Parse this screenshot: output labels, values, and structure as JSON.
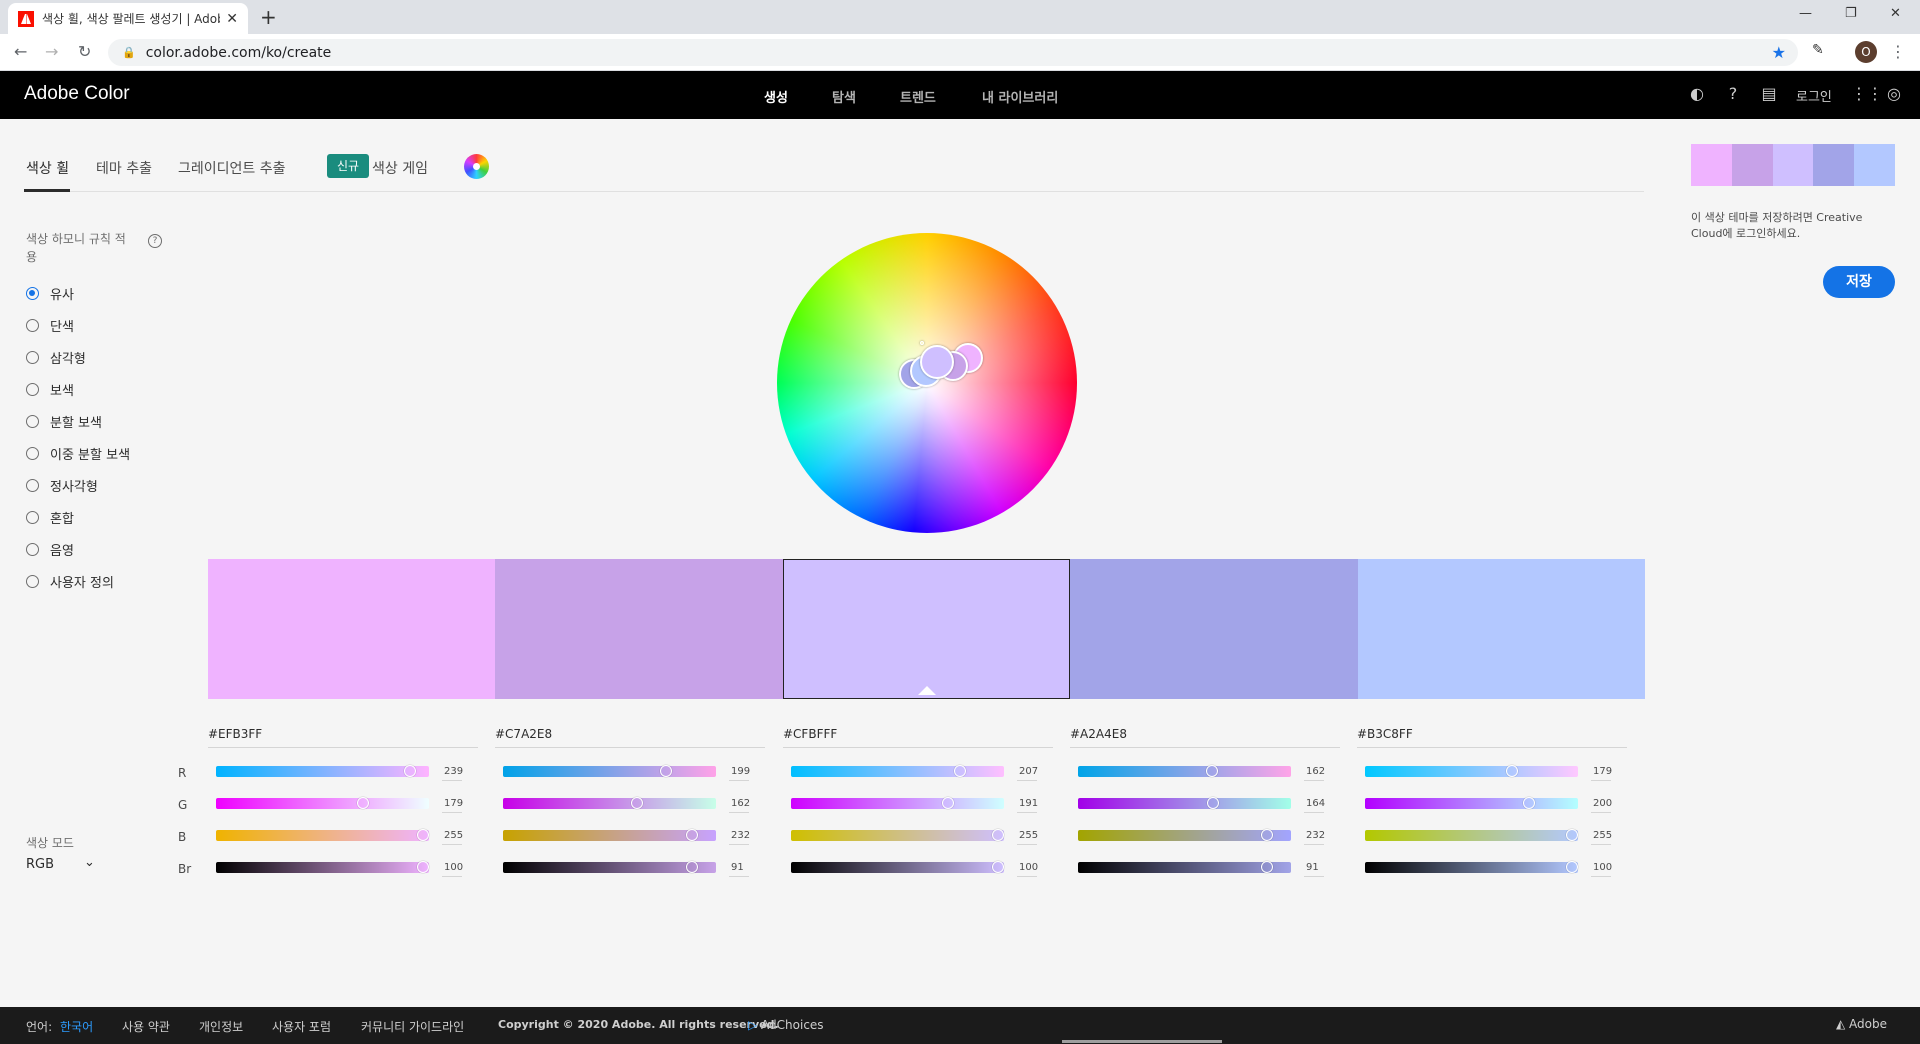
{
  "browser": {
    "tab_title": "색상 휠, 색상 팔레트 생성기 | Adobe Color",
    "url": "color.adobe.com/ko/create",
    "profile_initial": "O"
  },
  "header": {
    "brand": "Adobe Color",
    "nav": [
      "생성",
      "탐색",
      "트렌드",
      "내 라이브러리"
    ],
    "login": "로그인"
  },
  "subtabs": {
    "items": [
      "색상 휠",
      "테마 추출",
      "그레이디언트 추출",
      "색상 게임"
    ],
    "new_badge": "신규"
  },
  "rules": {
    "title": "색상 하모니 규칙 적용",
    "selected": "유사",
    "items": [
      "유사",
      "단색",
      "삼각형",
      "보색",
      "분할 보색",
      "이중 분할 보색",
      "정사각형",
      "혼합",
      "음영",
      "사용자 정의"
    ]
  },
  "color_mode": {
    "label": "색상 모드",
    "value": "RGB"
  },
  "channel_labels": [
    "R",
    "G",
    "B",
    "Br"
  ],
  "swatches": [
    {
      "hex": "#EFB3FF",
      "color": "#EFB3FF",
      "values": [
        "239",
        "179",
        "255",
        "100"
      ],
      "fractions": [
        0.937,
        0.702,
        1.0,
        1.0
      ]
    },
    {
      "hex": "#C7A2E8",
      "color": "#C7A2E8",
      "values": [
        "199",
        "162",
        "232",
        "91"
      ],
      "fractions": [
        0.78,
        0.635,
        0.91,
        0.91
      ]
    },
    {
      "hex": "#CFBFFF",
      "color": "#CFBFFF",
      "values": [
        "207",
        "191",
        "255",
        "100"
      ],
      "fractions": [
        0.812,
        0.749,
        1.0,
        1.0
      ]
    },
    {
      "hex": "#A2A4E8",
      "color": "#A2A4E8",
      "values": [
        "162",
        "164",
        "232",
        "91"
      ],
      "fractions": [
        0.635,
        0.643,
        0.91,
        0.91
      ]
    },
    {
      "hex": "#B3C8FF",
      "color": "#B3C8FF",
      "values": [
        "179",
        "200",
        "255",
        "100"
      ],
      "fractions": [
        0.702,
        0.784,
        1.0,
        1.0
      ]
    }
  ],
  "selected_swatch_index": 2,
  "right_panel": {
    "note": "이 색상 테마를 저장하려면 Creative Cloud에 로그인하세요.",
    "save": "저장"
  },
  "footer": {
    "lang_label": "언어:",
    "lang_value": "한국어",
    "links": [
      "사용 약관",
      "개인정보",
      "사용자 포럼",
      "커뮤니티 가이드라인"
    ],
    "copyright": "Copyright © 2020 Adobe. All rights reserved.",
    "adchoices": "AdChoices",
    "adobe": "Adobe"
  },
  "colors": {
    "accent": "#1473e6",
    "badge": "#1a8c7e"
  }
}
